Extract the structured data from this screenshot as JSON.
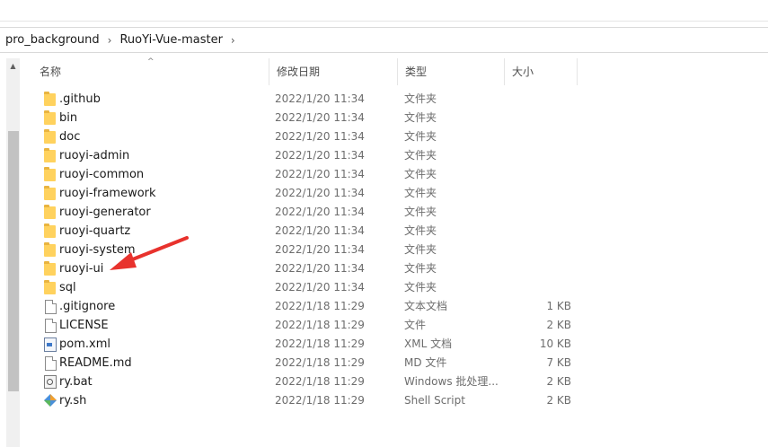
{
  "breadcrumb": [
    "pro_background",
    "RuoYi-Vue-master"
  ],
  "breadcrumb_separator": "›",
  "columns": {
    "name": "名称",
    "date": "修改日期",
    "type": "类型",
    "size": "大小"
  },
  "files": [
    {
      "icon": "folder-icon",
      "name": ".github",
      "date": "2022/1/20 11:34",
      "type": "文件夹",
      "size": ""
    },
    {
      "icon": "folder-icon",
      "name": "bin",
      "date": "2022/1/20 11:34",
      "type": "文件夹",
      "size": ""
    },
    {
      "icon": "folder-icon",
      "name": "doc",
      "date": "2022/1/20 11:34",
      "type": "文件夹",
      "size": ""
    },
    {
      "icon": "folder-icon",
      "name": "ruoyi-admin",
      "date": "2022/1/20 11:34",
      "type": "文件夹",
      "size": ""
    },
    {
      "icon": "folder-icon",
      "name": "ruoyi-common",
      "date": "2022/1/20 11:34",
      "type": "文件夹",
      "size": ""
    },
    {
      "icon": "folder-icon",
      "name": "ruoyi-framework",
      "date": "2022/1/20 11:34",
      "type": "文件夹",
      "size": ""
    },
    {
      "icon": "folder-icon",
      "name": "ruoyi-generator",
      "date": "2022/1/20 11:34",
      "type": "文件夹",
      "size": ""
    },
    {
      "icon": "folder-icon",
      "name": "ruoyi-quartz",
      "date": "2022/1/20 11:34",
      "type": "文件夹",
      "size": ""
    },
    {
      "icon": "folder-icon",
      "name": "ruoyi-system",
      "date": "2022/1/20 11:34",
      "type": "文件夹",
      "size": ""
    },
    {
      "icon": "folder-icon",
      "name": "ruoyi-ui",
      "date": "2022/1/20 11:34",
      "type": "文件夹",
      "size": ""
    },
    {
      "icon": "folder-icon",
      "name": "sql",
      "date": "2022/1/20 11:34",
      "type": "文件夹",
      "size": ""
    },
    {
      "icon": "file-icon",
      "name": ".gitignore",
      "date": "2022/1/18 11:29",
      "type": "文本文档",
      "size": "1 KB"
    },
    {
      "icon": "file-icon",
      "name": "LICENSE",
      "date": "2022/1/18 11:29",
      "type": "文件",
      "size": "2 KB"
    },
    {
      "icon": "xml-file-icon",
      "name": "pom.xml",
      "date": "2022/1/18 11:29",
      "type": "XML 文档",
      "size": "10 KB"
    },
    {
      "icon": "file-icon",
      "name": "README.md",
      "date": "2022/1/18 11:29",
      "type": "MD 文件",
      "size": "7 KB"
    },
    {
      "icon": "batch-file-icon",
      "name": "ry.bat",
      "date": "2022/1/18 11:29",
      "type": "Windows 批处理...",
      "size": "2 KB"
    },
    {
      "icon": "shell-script-icon",
      "name": "ry.sh",
      "date": "2022/1/18 11:29",
      "type": "Shell Script",
      "size": "2 KB"
    }
  ],
  "annotation": {
    "target": "ruoyi-ui",
    "color": "#e8322d"
  },
  "colors": {
    "folder": "#ffd25e",
    "scroll_thumb": "#c2c2c2",
    "muted_text": "#6d6d6d"
  }
}
